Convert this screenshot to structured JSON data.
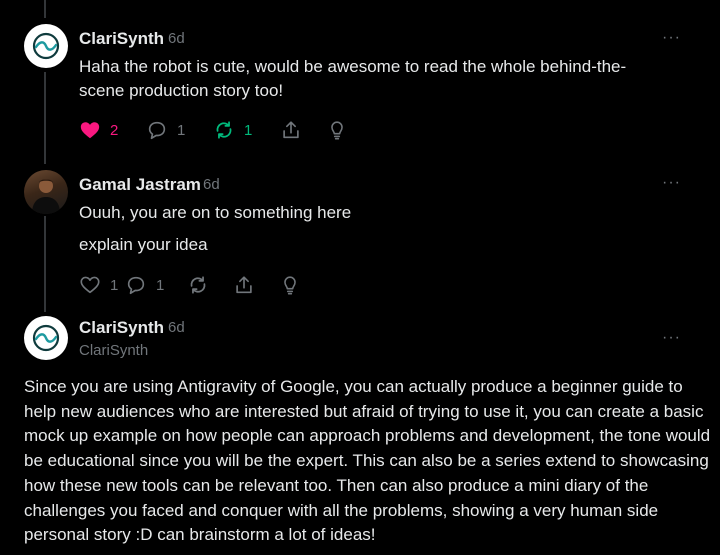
{
  "posts": [
    {
      "author": "ClariSynth",
      "time": "6d",
      "lines": [
        "Haha the robot is cute, would be awesome to read the whole behind-the-",
        "scene production story too!"
      ],
      "likes": "2",
      "replies": "1",
      "reposts": "1",
      "liked": true,
      "reposted": true
    },
    {
      "author": "Gamal Jastram",
      "time": "6d",
      "lines": [
        "Ouuh, you are on to something here",
        "explain your idea"
      ],
      "likes": "1",
      "replies": "1",
      "reposts": ""
    },
    {
      "author": "ClariSynth",
      "time": "6d",
      "handle": "ClariSynth",
      "body": "Since you are using Antigravity of Google, you can actually produce a beginner guide to help new audiences who are interested but afraid of trying to use it, you can create a basic mock up example on how people can approach problems and development, the tone would be educational since you will be the expert. This can also be a series extend to showcasing how these new tools can be relevant too. Then can also produce a mini diary of the challenges you faced and conquer with all the problems, showing a very human side personal story :D can brainstorm a lot of ideas!"
    }
  ],
  "more_label": "···",
  "colors": {
    "like": "#f91880",
    "repost": "#00ba7c",
    "muted": "#71767b",
    "background": "#000000"
  },
  "icons": [
    "heart-icon",
    "reply-icon",
    "repost-icon",
    "share-icon",
    "bulb-icon",
    "more-icon"
  ]
}
